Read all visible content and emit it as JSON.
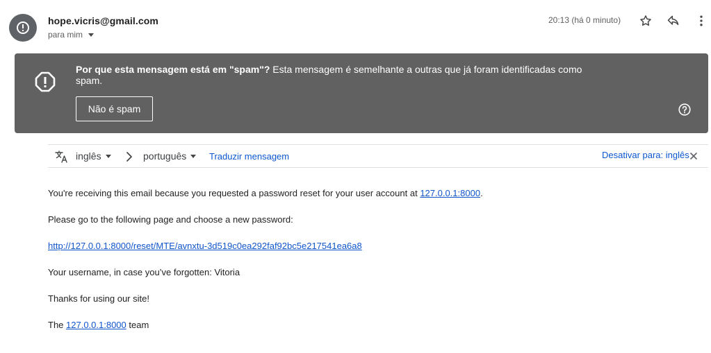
{
  "header": {
    "sender": "hope.vicris@gmail.com",
    "recipient_label": "para mim",
    "timestamp": "20:13 (há 0 minuto)",
    "icons": [
      "alert-avatar-icon",
      "star-icon",
      "reply-icon",
      "more-vert-icon"
    ]
  },
  "spam_banner": {
    "question": "Por que esta mensagem está em \"spam\"?",
    "explanation": " Esta mensagem é semelhante a outras que já foram identificadas como spam.",
    "not_spam_button": "Não é spam",
    "background_color": "#616161",
    "icons": [
      "warning-icon",
      "help-icon"
    ]
  },
  "translate_bar": {
    "source_language": "inglês",
    "target_language": "português",
    "translate_link": "Traduzir mensagem",
    "disable_link": "Desativar para: inglês",
    "link_color": "#0b57d0",
    "icons": [
      "translate-icon",
      "chevron-right-icon",
      "close-icon"
    ]
  },
  "message": {
    "line1_prefix": "You're receiving this email because you requested a password reset for your user account at ",
    "line1_link": "127.0.0.1:8000",
    "line1_suffix": ".",
    "line2": "Please go to the following page and choose a new password:",
    "reset_link": "http://127.0.0.1:8000/reset/MTE/avnxtu-3d519c0ea292faf92bc5e217541ea6a8",
    "line4": "Your username, in case you’ve forgotten: Vitoria",
    "line5": "Thanks for using our site!",
    "line6_prefix": "The ",
    "line6_link": "127.0.0.1:8000",
    "line6_suffix": " team",
    "link_color": "#1155cc"
  }
}
